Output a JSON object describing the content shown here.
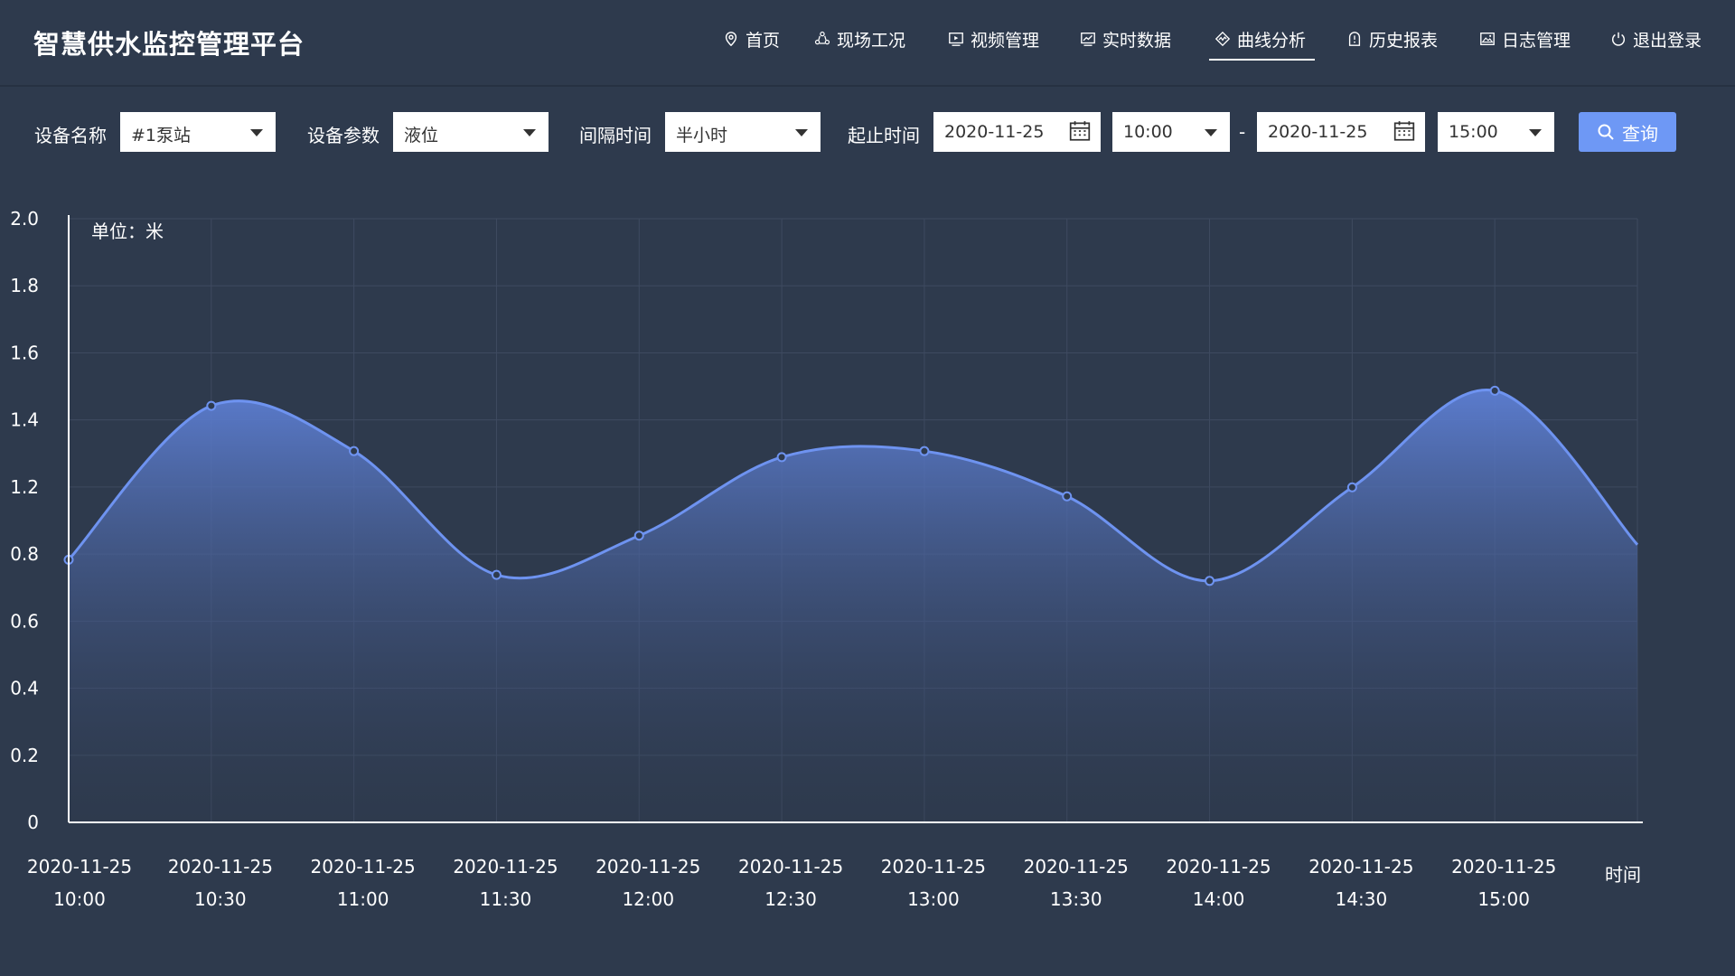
{
  "app": {
    "title": "智慧供水监控管理平台"
  },
  "nav": [
    {
      "label": "首页",
      "icon": "location-pin-icon"
    },
    {
      "label": "现场工况",
      "icon": "cluster-icon"
    },
    {
      "label": "视频管理",
      "icon": "video-icon"
    },
    {
      "label": "实时数据",
      "icon": "realtime-chart-icon"
    },
    {
      "label": "曲线分析",
      "icon": "curve-analysis-icon",
      "active": true
    },
    {
      "label": "历史报表",
      "icon": "history-report-icon"
    },
    {
      "label": "日志管理",
      "icon": "log-image-icon"
    },
    {
      "label": "退出登录",
      "icon": "power-icon"
    }
  ],
  "filters": {
    "device_name_label": "设备名称",
    "device_name_value": "#1泵站",
    "device_param_label": "设备参数",
    "device_param_value": "液位",
    "interval_label": "间隔时间",
    "interval_value": "半小时",
    "range_label": "起止时间",
    "start_date": "2020-11-25",
    "start_time": "10:00",
    "separator": "-",
    "end_date": "2020-11-25",
    "end_time": "15:00",
    "query_label": "查询"
  },
  "chart_data": {
    "type": "area",
    "unit_label": "单位：米",
    "xlabel": "时间",
    "categories": [
      [
        "2020-11-25",
        "10:00"
      ],
      [
        "2020-11-25",
        "10:30"
      ],
      [
        "2020-11-25",
        "11:00"
      ],
      [
        "2020-11-25",
        "11:30"
      ],
      [
        "2020-11-25",
        "12:00"
      ],
      [
        "2020-11-25",
        "12:30"
      ],
      [
        "2020-11-25",
        "13:00"
      ],
      [
        "2020-11-25",
        "13:30"
      ],
      [
        "2020-11-25",
        "14:00"
      ],
      [
        "2020-11-25",
        "14:30"
      ],
      [
        "2020-11-25",
        "15:00"
      ]
    ],
    "series": [
      {
        "values": [
          0.87,
          1.38,
          1.23,
          0.82,
          0.95,
          1.21,
          1.23,
          1.08,
          0.8,
          1.11,
          1.43
        ]
      }
    ],
    "end_value": 0.92,
    "ylim": [
      0,
      2.0
    ],
    "y_ticks": [
      "0",
      "0.2",
      "0.4",
      "0.6",
      "0.8",
      "1.2",
      "1.4",
      "1.6",
      "1.8",
      "2.0"
    ],
    "grid": true,
    "colors": {
      "line": "#6e93f0",
      "area_top": "#5d7fd4",
      "area_bottom": "#2e3a4d",
      "grid": "#3e4a60"
    }
  }
}
